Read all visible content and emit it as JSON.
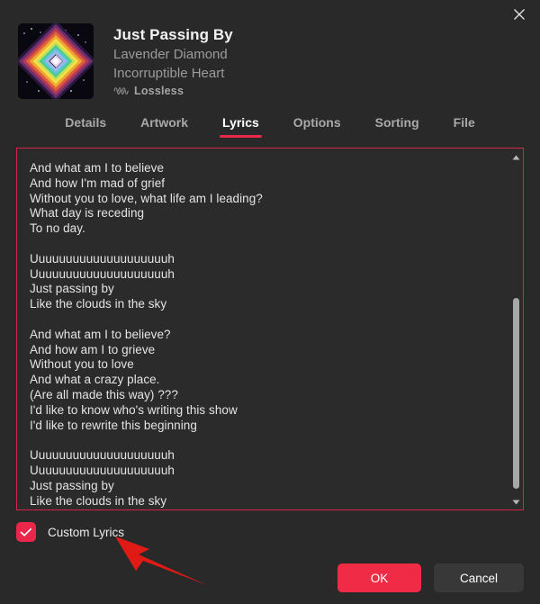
{
  "window": {
    "close_icon": "close-icon"
  },
  "track": {
    "title": "Just Passing By",
    "artist": "Lavender Diamond",
    "album": "Incorruptible Heart",
    "quality_label": "Lossless",
    "quality_icon": "lossless-waveform-icon",
    "artwork_alt": "pixelated rainbow diamond album art"
  },
  "tabs": [
    {
      "label": "Details",
      "active": false
    },
    {
      "label": "Artwork",
      "active": false
    },
    {
      "label": "Lyrics",
      "active": true
    },
    {
      "label": "Options",
      "active": false
    },
    {
      "label": "Sorting",
      "active": false
    },
    {
      "label": "File",
      "active": false
    }
  ],
  "lyrics": {
    "lines": [
      "And what am I to believe",
      "And how I'm mad of grief",
      "Without you to love, what life am I leading?",
      "What day is receding",
      "To no day.",
      "",
      "Uuuuuuuuuuuuuuuuuuuuh",
      "Uuuuuuuuuuuuuuuuuuuuh",
      "Just passing by",
      "Like the clouds in the sky",
      "",
      "And what am I to believe?",
      "And how am I to grieve",
      "Without you to love",
      "And what a crazy place.",
      "(Are all made this way) ???",
      "I'd like to know who's writing this show",
      "I'd like to rewrite this beginning",
      "",
      "Uuuuuuuuuuuuuuuuuuuuh",
      "Uuuuuuuuuuuuuuuuuuuuh",
      "Just passing by",
      "Like the clouds in the sky"
    ]
  },
  "scrollbar": {
    "up_icon": "scroll-up-arrow-icon",
    "down_icon": "scroll-down-arrow-icon"
  },
  "footer": {
    "custom_lyrics_label": "Custom Lyrics",
    "custom_lyrics_checked": true,
    "ok_label": "OK",
    "cancel_label": "Cancel"
  },
  "annotation": {
    "arrow_icon": "annotation-arrow-icon",
    "arrow_color": "#e01b15",
    "highlight_color": "#d32348"
  },
  "colors": {
    "accent": "#e8274b",
    "primary_button": "#ef2b46",
    "window_bg": "#292929",
    "field_bg": "#2b2b2b"
  }
}
